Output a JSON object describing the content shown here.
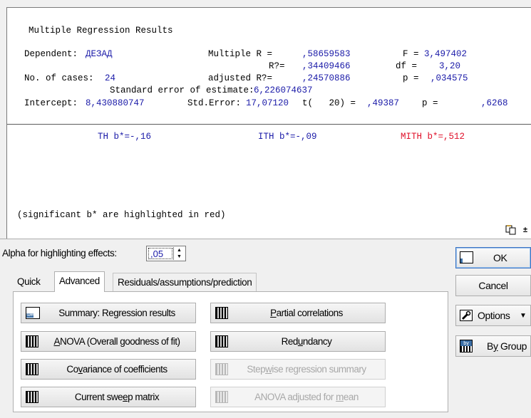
{
  "results": {
    "title": "Multiple Regression Results",
    "dependent_label": "Dependent:",
    "dependent_value": "ДЕЗАД",
    "multiple_r_label": "Multiple R =",
    "multiple_r_value": ",58659583",
    "f_label": "F =",
    "f_value": "3,497402",
    "r2_label": "R?=",
    "r2_value": ",34409466",
    "df_label": "df =",
    "df_value": "3,20",
    "cases_label": "No. of cases:",
    "cases_value": "24",
    "adj_r2_label": "adjusted R?=",
    "adj_r2_value": ",24570886",
    "p_label": "p =",
    "p_value": ",034575",
    "std_err_label": "Standard error of estimate:",
    "std_err_value": "6,226074637",
    "intercept_label": "Intercept:",
    "intercept_value": "8,430880747",
    "intercept_se_label": "Std.Error:",
    "intercept_se_value": "17,07120",
    "t_label": "t(   20) =",
    "t_value": ",49387",
    "intercept_p_label": "p =",
    "intercept_p_value": ",6268",
    "beta1": "TH b*=-,16",
    "beta2": "ITH b*=-,09",
    "beta3": "MITH b*=,512",
    "footnote": "(significant b* are highlighted in red)"
  },
  "dialog": {
    "alpha_label": "Alpha for highlighting effects:",
    "alpha_value": ",05",
    "tabs": [
      "Quick",
      "Advanced",
      "Residuals/assumptions/prediction"
    ],
    "active_tab": "Advanced",
    "buttons": {
      "summary": {
        "pre": "Summary:  Re",
        "u": "g",
        "post": "ression results"
      },
      "partial": {
        "pre": "",
        "u": "P",
        "post": "artial correlations"
      },
      "anova": {
        "pre": "",
        "u": "A",
        "post": "NOVA (Overall goodness of fit)"
      },
      "redundancy": {
        "pre": "Red",
        "u": "u",
        "post": "ndancy"
      },
      "covariance": {
        "pre": "Co",
        "u": "v",
        "post": "ariance of coefficients"
      },
      "stepwise": {
        "pre": "Step",
        "u": "w",
        "post": "ise regression summary"
      },
      "sweep": {
        "pre": "Current swe",
        "u": "e",
        "post": "p matrix"
      },
      "anova_adj": {
        "pre": "ANOVA adjusted for ",
        "u": "m",
        "post": "ean"
      }
    },
    "side": {
      "ok": "OK",
      "cancel": "Cancel",
      "options": "Options",
      "bygroup": {
        "pre": "B",
        "u": "y",
        "post": " Group"
      }
    }
  }
}
